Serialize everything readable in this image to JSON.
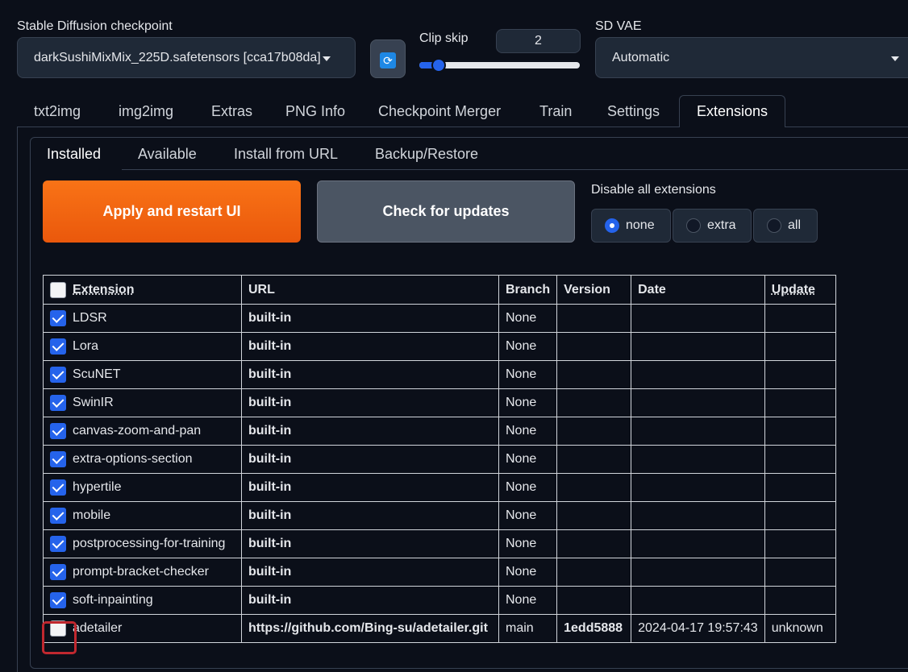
{
  "top": {
    "checkpoint_label": "Stable Diffusion checkpoint",
    "checkpoint_value": "darkSushiMixMix_225D.safetensors [cca17b08da]",
    "clip_skip_label": "Clip skip",
    "clip_skip_value": "2",
    "clip_skip_level": 0.12,
    "vae_label": "SD VAE",
    "vae_value": "Automatic",
    "refresh_icon": "refresh-icon"
  },
  "main_tabs": [
    "txt2img",
    "img2img",
    "Extras",
    "PNG Info",
    "Checkpoint Merger",
    "Train",
    "Settings",
    "Extensions"
  ],
  "sub_tabs": [
    "Installed",
    "Available",
    "Install from URL",
    "Backup/Restore"
  ],
  "actions": {
    "apply_label": "Apply and restart UI",
    "check_label": "Check for updates"
  },
  "disable": {
    "label": "Disable all extensions",
    "options": [
      "none",
      "extra",
      "all"
    ],
    "selected": "none"
  },
  "table": {
    "headers": [
      "Extension",
      "URL",
      "Branch",
      "Version",
      "Date",
      "Update"
    ],
    "rows": [
      {
        "name": "LDSR",
        "url": "built-in",
        "branch": "None",
        "version": "",
        "date": "",
        "update": "",
        "checked": true
      },
      {
        "name": "Lora",
        "url": "built-in",
        "branch": "None",
        "version": "",
        "date": "",
        "update": "",
        "checked": true
      },
      {
        "name": "ScuNET",
        "url": "built-in",
        "branch": "None",
        "version": "",
        "date": "",
        "update": "",
        "checked": true
      },
      {
        "name": "SwinIR",
        "url": "built-in",
        "branch": "None",
        "version": "",
        "date": "",
        "update": "",
        "checked": true
      },
      {
        "name": "canvas-zoom-and-pan",
        "url": "built-in",
        "branch": "None",
        "version": "",
        "date": "",
        "update": "",
        "checked": true
      },
      {
        "name": "extra-options-section",
        "url": "built-in",
        "branch": "None",
        "version": "",
        "date": "",
        "update": "",
        "checked": true
      },
      {
        "name": "hypertile",
        "url": "built-in",
        "branch": "None",
        "version": "",
        "date": "",
        "update": "",
        "checked": true
      },
      {
        "name": "mobile",
        "url": "built-in",
        "branch": "None",
        "version": "",
        "date": "",
        "update": "",
        "checked": true
      },
      {
        "name": "postprocessing-for-training",
        "url": "built-in",
        "branch": "None",
        "version": "",
        "date": "",
        "update": "",
        "checked": true
      },
      {
        "name": "prompt-bracket-checker",
        "url": "built-in",
        "branch": "None",
        "version": "",
        "date": "",
        "update": "",
        "checked": true
      },
      {
        "name": "soft-inpainting",
        "url": "built-in",
        "branch": "None",
        "version": "",
        "date": "",
        "update": "",
        "checked": true
      },
      {
        "name": "adetailer",
        "url": "https://github.com/Bing-su/adetailer.git",
        "branch": "main",
        "version": "1edd5888",
        "date": "2024-04-17 19:57:43",
        "update": "unknown",
        "checked": false
      }
    ]
  },
  "colors": {
    "background": "#0b0f19",
    "accent": "#2563eb",
    "primary_button": "#f97316",
    "highlight": "#c0282f"
  }
}
